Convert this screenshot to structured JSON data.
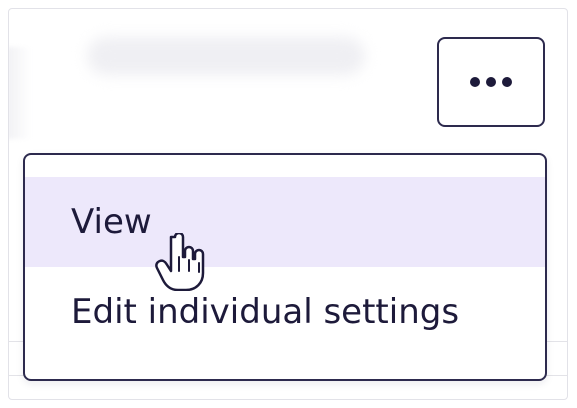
{
  "menu": {
    "items": [
      {
        "label": "View"
      },
      {
        "label": "Edit individual settings"
      }
    ]
  },
  "actions": {
    "more_icon": "more-horizontal-icon"
  },
  "cursor": {
    "icon": "hand-pointer-icon"
  },
  "colors": {
    "menu_border": "#2d2a4e",
    "text": "#1d1a3a",
    "highlight": "#ede8fb",
    "divider": "#e3e3e8"
  }
}
